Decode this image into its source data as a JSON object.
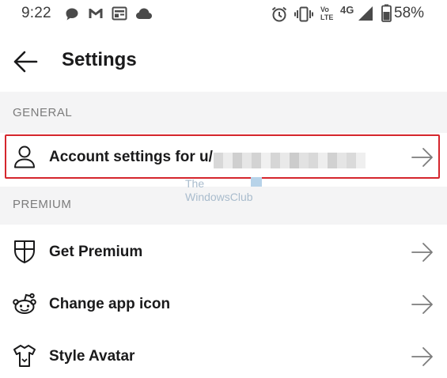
{
  "status_bar": {
    "time": "9:22",
    "left_icons": [
      "chat-bubble-icon",
      "gmail-icon",
      "news-icon",
      "cloud-icon"
    ],
    "right_icons": [
      "alarm-icon",
      "vibrate-icon",
      "volte-icon",
      "4g-icon",
      "signal-icon",
      "battery-icon"
    ],
    "network_label": "4G",
    "volte_label": "Vo LTE",
    "battery": "58%"
  },
  "app_bar": {
    "title": "Settings"
  },
  "sections": {
    "general": {
      "header": "GENERAL",
      "items": [
        {
          "label": "Account settings for u/",
          "icon": "user-icon",
          "arrow": "arrow-right-icon",
          "highlighted": true,
          "highlight_color": "#d5262d"
        }
      ]
    },
    "premium": {
      "header": "PREMIUM",
      "items": [
        {
          "label": "Get Premium",
          "icon": "shield-icon",
          "arrow": "arrow-right-icon"
        },
        {
          "label": "Change app icon",
          "icon": "reddit-alien-icon",
          "arrow": "arrow-right-icon"
        },
        {
          "label": "Style Avatar",
          "icon": "shirt-icon",
          "arrow": "arrow-right-icon"
        }
      ]
    }
  },
  "watermark": {
    "line1": "The",
    "line2": "WindowsClub"
  },
  "colors": {
    "background": "#ffffff",
    "section_header_bg": "#f4f4f5",
    "section_header_text": "#7c7c7c",
    "text": "#1a1a1b",
    "highlight": "#d5262d"
  }
}
